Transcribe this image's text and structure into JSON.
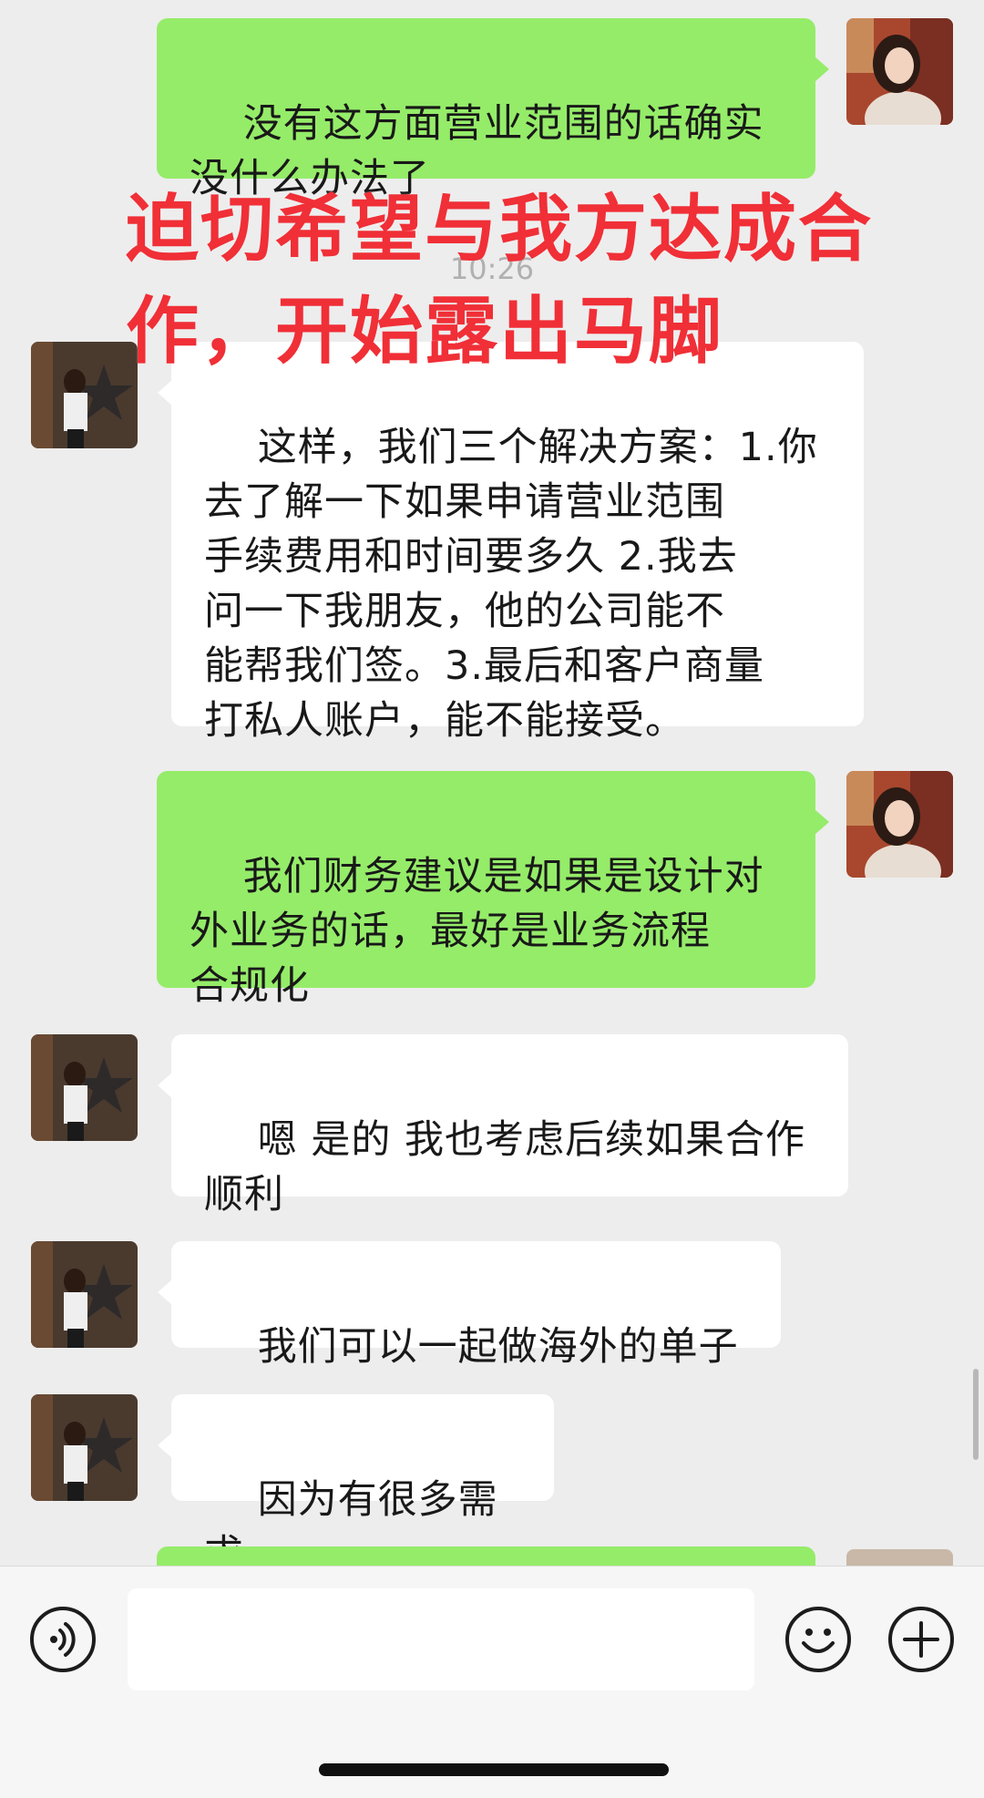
{
  "chat": {
    "timestamp": "10:26",
    "overlay_caption": "迫切希望与我方达成合\n作，开始露出马脚",
    "messages": [
      {
        "sender": "self",
        "text": "没有这方面营业范围的话确实\n没什么办法了"
      },
      {
        "sender": "contact",
        "text": "这样，我们三个解决方案：1.你\n去了解一下如果申请营业范围\n手续费用和时间要多久 2.我去\n问一下我朋友，他的公司能不\n能帮我们签。3.最后和客户商量\n打私人账户，能不能接受。"
      },
      {
        "sender": "self",
        "text": "我们财务建议是如果是设计对\n外业务的话，最好是业务流程\n合规化"
      },
      {
        "sender": "contact",
        "text": "嗯 是的 我也考虑后续如果合作\n顺利"
      },
      {
        "sender": "contact",
        "text": "我们可以一起做海外的单子"
      },
      {
        "sender": "contact",
        "text": "因为有很多需求"
      }
    ]
  },
  "input_bar": {
    "voice_icon": "voice-icon",
    "emoji_icon": "emoji-icon",
    "plus_icon": "plus-icon",
    "message_value": ""
  },
  "colors": {
    "background": "#ededed",
    "outgoing_bubble": "#95ec69",
    "incoming_bubble": "#ffffff",
    "overlay_text": "#f02f37"
  }
}
